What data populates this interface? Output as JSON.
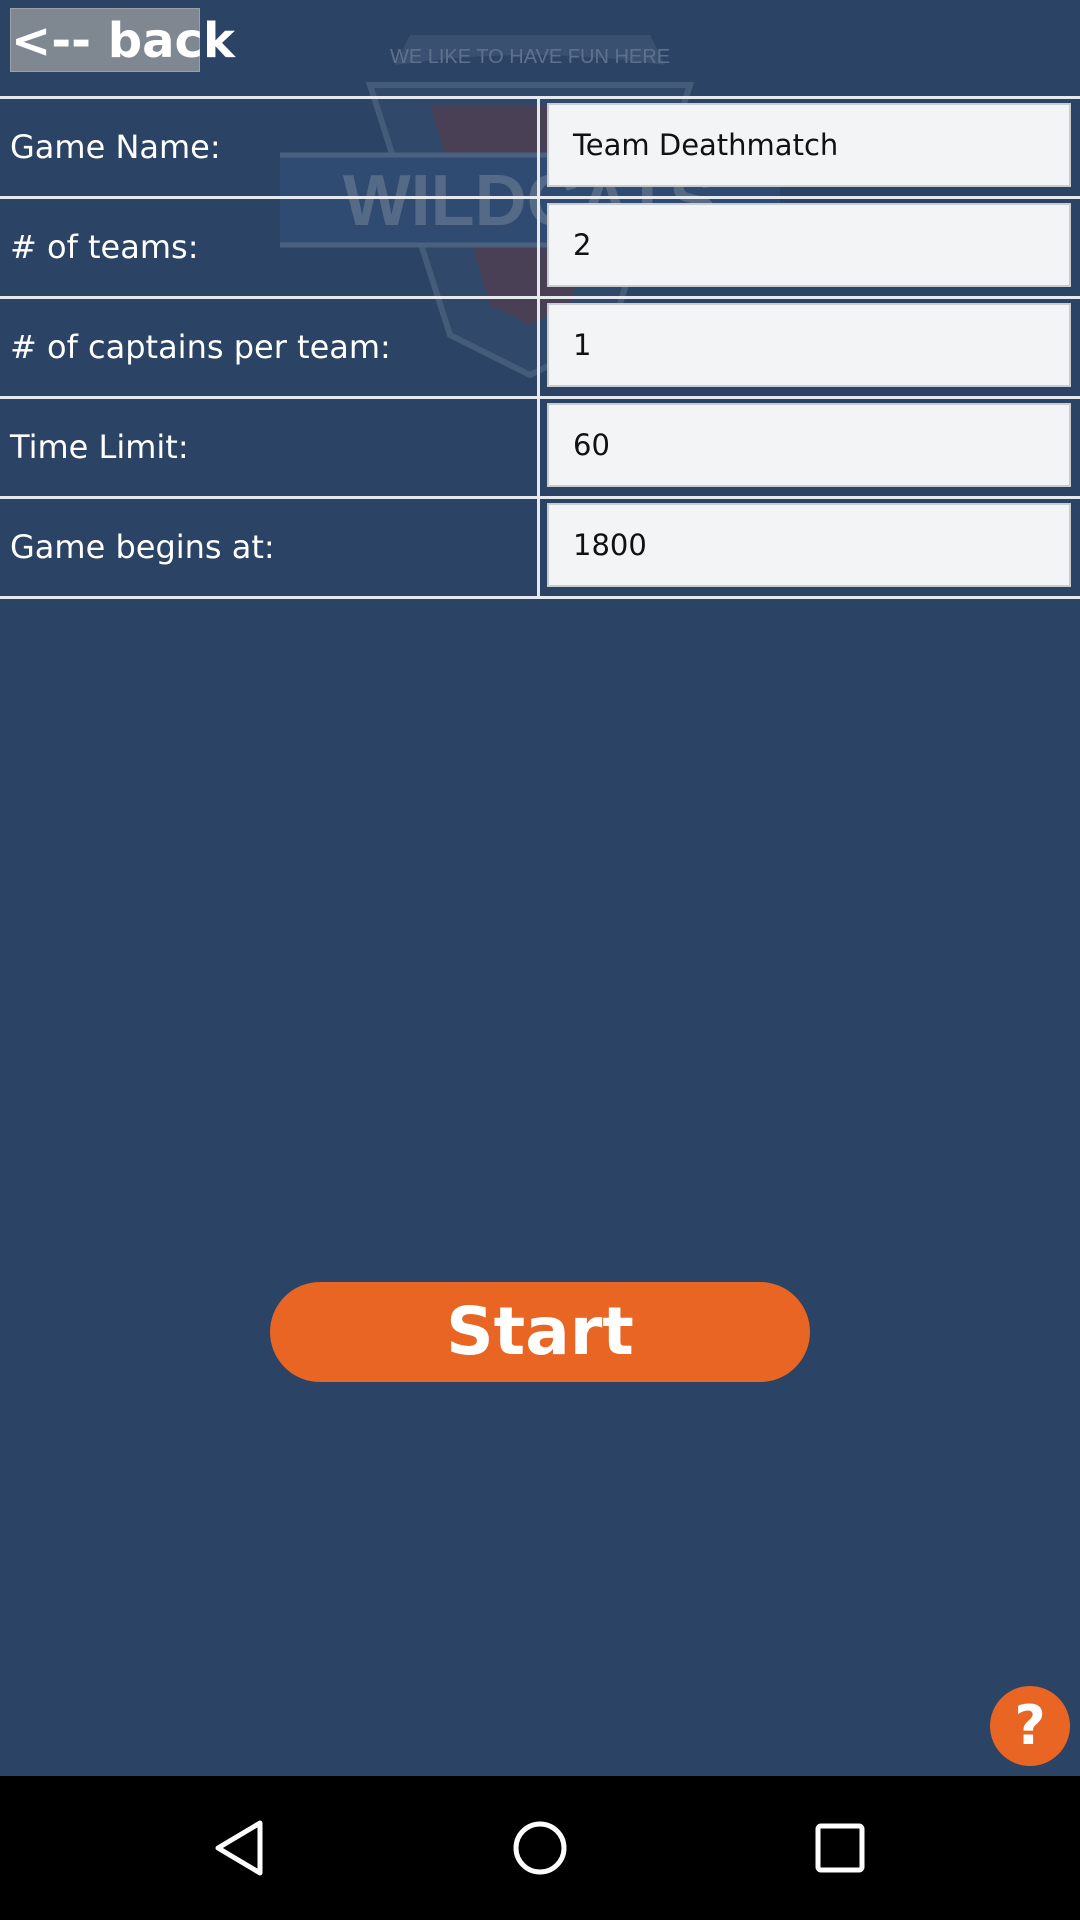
{
  "header": {
    "back_label": "<-- back"
  },
  "watermark": {
    "tagline": "WE LIKE TO HAVE FUN HERE",
    "brand": "WILDCATS"
  },
  "settings": [
    {
      "label": "Game Name:",
      "value": "Team Deathmatch"
    },
    {
      "label": "# of teams:",
      "value": "2"
    },
    {
      "label": "# of captains per team:",
      "value": "1"
    },
    {
      "label": "Time Limit:",
      "value": "60"
    },
    {
      "label": "Game begins at:",
      "value": "1800"
    }
  ],
  "actions": {
    "start_label": "Start",
    "help_label": "?"
  },
  "nav": {
    "back_icon": "triangle-back-icon",
    "home_icon": "circle-home-icon",
    "recents_icon": "square-recents-icon"
  },
  "colors": {
    "background": "#2b4364",
    "accent": "#e86524",
    "back_button": "#7f8791",
    "field_bg": "#f3f4f6"
  }
}
